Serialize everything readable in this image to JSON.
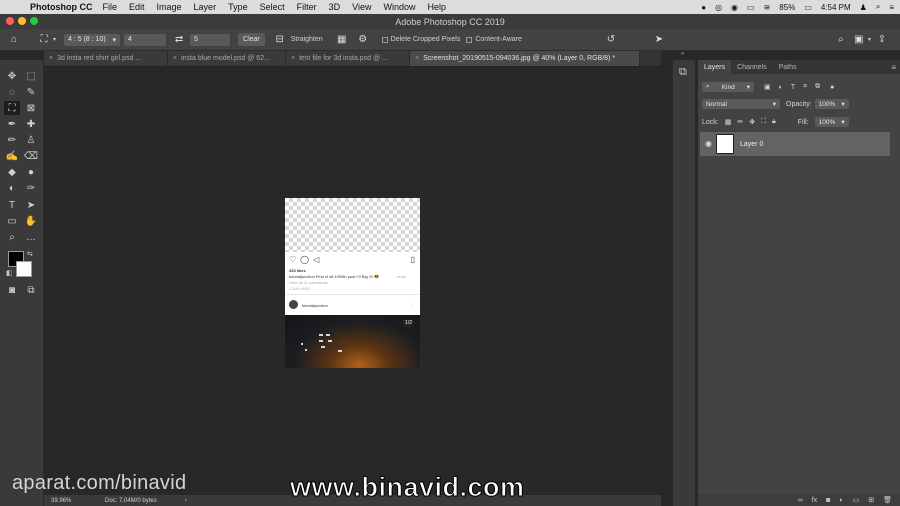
{
  "menubar": {
    "app_name": "Photoshop CC",
    "items": [
      "File",
      "Edit",
      "Image",
      "Layer",
      "Type",
      "Select",
      "Filter",
      "3D",
      "View",
      "Window",
      "Help"
    ],
    "battery": "85%",
    "time": "4:54 PM"
  },
  "window": {
    "title": "Adobe Photoshop CC 2019"
  },
  "options_bar": {
    "ratio_preset": "4 : 5 (8 : 10)",
    "width_value": "4",
    "height_value": "5",
    "clear_label": "Clear",
    "straighten_label": "Straighten",
    "delete_cropped_label": "Delete Cropped Pixels",
    "content_aware_label": "Content-Aware"
  },
  "tabs": [
    {
      "label": "3d insta red shirt girl.psd ..."
    },
    {
      "label": "insta blue model.psd @ 62..."
    },
    {
      "label": "test file for 3d insta.psd @ ..."
    },
    {
      "label": "Screenshot_20190515-094036.jpg @ 40% (Layer 0, RGB/8) *"
    }
  ],
  "document": {
    "likes": "333 likes",
    "caption": "tutorialjunction First of all 1000th post !!!! Big !!!! 😎",
    "caption_more": "more",
    "view_comments": "View all 11 comments",
    "time_ago": "1 DAY AGO",
    "username": "tutorialjunction",
    "photo_badge": "1/2"
  },
  "status_bar": {
    "zoom": "39.96%",
    "doc_info": "Doc: 7.04M/0 bytes"
  },
  "panel": {
    "tabs": [
      "Layers",
      "Channels",
      "Paths"
    ],
    "filter_kind": "Kind",
    "blend_mode": "Normal",
    "opacity_label": "Opacity:",
    "opacity_value": "100%",
    "lock_label": "Lock:",
    "fill_label": "Fill:",
    "fill_value": "100%",
    "layers": [
      {
        "name": "Layer 0"
      }
    ]
  },
  "watermarks": {
    "left": "aparat.com/binavid",
    "center": "www.binavid.com"
  }
}
